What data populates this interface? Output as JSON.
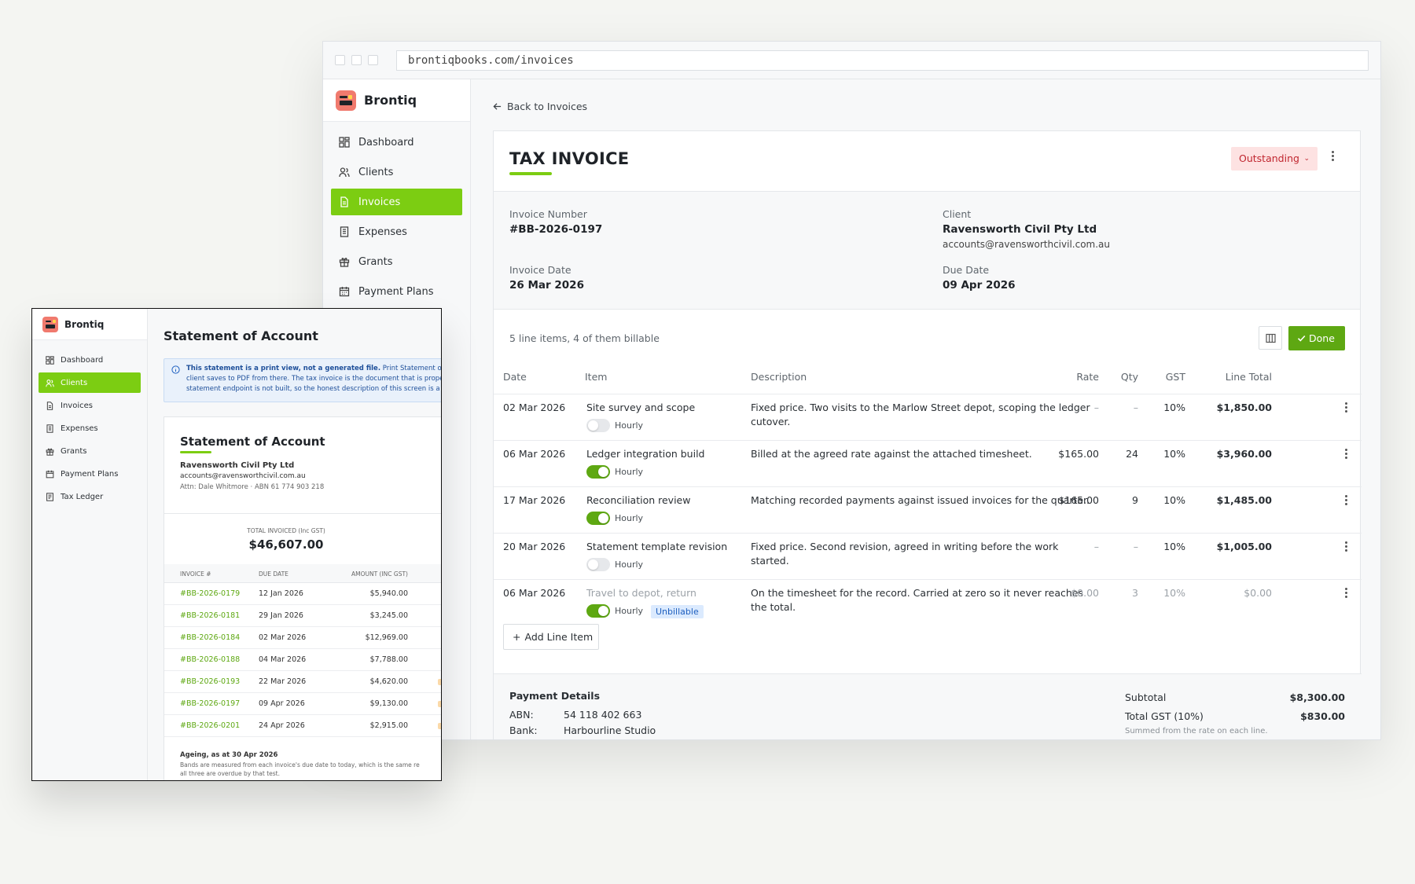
{
  "browser": {
    "url": "brontiqbooks.com/invoices"
  },
  "app": {
    "brand": "Brontiq",
    "nav": [
      {
        "label": "Dashboard",
        "icon": "dashboard-icon"
      },
      {
        "label": "Clients",
        "icon": "users-icon"
      },
      {
        "label": "Invoices",
        "icon": "document-icon",
        "active": true
      },
      {
        "label": "Expenses",
        "icon": "receipt-icon"
      },
      {
        "label": "Grants",
        "icon": "gift-icon"
      },
      {
        "label": "Payment Plans",
        "icon": "calendar-icon"
      }
    ]
  },
  "invoice": {
    "back_label": "Back to Invoices",
    "title": "TAX INVOICE",
    "status": "Outstanding",
    "number_label": "Invoice Number",
    "number": "#BB-2026-0197",
    "client_label": "Client",
    "client_name": "Ravensworth Civil Pty Ltd",
    "client_email": "accounts@ravensworthcivil.com.au",
    "date_label": "Invoice Date",
    "date": "26 Mar 2026",
    "due_label": "Due Date",
    "due": "09 Apr 2026",
    "line_summary": "5 line items, 4 of them billable",
    "done_label": "Done",
    "columns": [
      "Date",
      "Item",
      "Description",
      "Rate",
      "Qty",
      "GST",
      "Line Total"
    ],
    "line_items": [
      {
        "date": "02 Mar 2026",
        "item": "Site survey and scope",
        "desc1": "Fixed price. Two visits to the Marlow Street depot, scoping the ledger",
        "desc2": "cutover.",
        "rate": "–",
        "qty": "–",
        "gst": "10%",
        "total": "$1,850.00",
        "hourly_label": "Hourly",
        "hourly": false
      },
      {
        "date": "06 Mar 2026",
        "item": "Ledger integration build",
        "desc1": "Billed at the agreed rate against the attached timesheet.",
        "desc2": "",
        "rate": "$165.00",
        "qty": "24",
        "gst": "10%",
        "total": "$3,960.00",
        "hourly_label": "Hourly",
        "hourly": true
      },
      {
        "date": "17 Mar 2026",
        "item": "Reconciliation review",
        "desc1": "Matching recorded payments against issued invoices for the quarter.",
        "desc2": "",
        "rate": "$165.00",
        "qty": "9",
        "gst": "10%",
        "total": "$1,485.00",
        "hourly_label": "Hourly",
        "hourly": true
      },
      {
        "date": "20 Mar 2026",
        "item": "Statement template revision",
        "desc1": "Fixed price. Second revision, agreed in writing before the work",
        "desc2": "started.",
        "rate": "–",
        "qty": "–",
        "gst": "10%",
        "total": "$1,005.00",
        "hourly_label": "Hourly",
        "hourly": false
      },
      {
        "date": "06 Mar 2026",
        "item": "Travel to depot, return",
        "desc1": "On the timesheet for the record. Carried at zero so it never reaches",
        "desc2": "the total.",
        "rate": "$0.00",
        "qty": "3",
        "gst": "10%",
        "total": "$0.00",
        "hourly_label": "Hourly",
        "hourly": true,
        "badge": "Unbillable"
      }
    ],
    "add_line_label": "Add Line Item",
    "payment_title": "Payment Details",
    "abn_label": "ABN:",
    "abn": "54 118 402 663",
    "bank_label": "Bank:",
    "bank": "Harbourline Studio",
    "subtotal_label": "Subtotal",
    "subtotal": "$8,300.00",
    "gst_label": "Total GST (10%)",
    "gst_total": "$830.00",
    "gst_note": "Summed from the rate on each line."
  },
  "statement_window": {
    "brand": "Brontiq",
    "nav": [
      {
        "label": "Dashboard",
        "icon": "dashboard-icon"
      },
      {
        "label": "Clients",
        "icon": "users-icon",
        "active": true
      },
      {
        "label": "Invoices",
        "icon": "document-icon"
      },
      {
        "label": "Expenses",
        "icon": "receipt-icon"
      },
      {
        "label": "Grants",
        "icon": "gift-icon"
      },
      {
        "label": "Payment Plans",
        "icon": "calendar-icon"
      },
      {
        "label": "Tax Ledger",
        "icon": "ledger-icon"
      }
    ],
    "page_title": "Statement of Account",
    "info_bold": "This statement is a print view, not a generated file.",
    "info_rest": "Print Statement of",
    "info_line2": "client saves to PDF from there. The tax invoice is the document that is prope",
    "info_line3": "statement endpoint is not built, so the honest description of this screen is a",
    "card_title": "Statement of Account",
    "client_name": "Ravensworth Civil Pty Ltd",
    "client_email": "accounts@ravensworthcivil.com.au",
    "attn": "Attn: Dale Whitmore · ABN 61 774 903 218",
    "total_label": "TOTAL INVOICED (Inc GST)",
    "total_value": "$46,607.00",
    "columns": [
      "INVOICE #",
      "DUE DATE",
      "AMOUNT (INC GST)"
    ],
    "rows": [
      {
        "invoice": "#BB-2026-0179",
        "due": "12 Jan 2026",
        "amount": "$5,940.00",
        "flag": false
      },
      {
        "invoice": "#BB-2026-0181",
        "due": "29 Jan 2026",
        "amount": "$3,245.00",
        "flag": false
      },
      {
        "invoice": "#BB-2026-0184",
        "due": "02 Mar 2026",
        "amount": "$12,969.00",
        "flag": false
      },
      {
        "invoice": "#BB-2026-0188",
        "due": "04 Mar 2026",
        "amount": "$7,788.00",
        "flag": false
      },
      {
        "invoice": "#BB-2026-0193",
        "due": "22 Mar 2026",
        "amount": "$4,620.00",
        "flag": true
      },
      {
        "invoice": "#BB-2026-0197",
        "due": "09 Apr 2026",
        "amount": "$9,130.00",
        "flag": true
      },
      {
        "invoice": "#BB-2026-0201",
        "due": "24 Apr 2026",
        "amount": "$2,915.00",
        "flag": true
      }
    ],
    "ageing_title": "Ageing, as at 30 Apr 2026",
    "ageing_line1": "Bands are measured from each invoice's due date to today, which is the same re",
    "ageing_line2": "all three are overdue by that test."
  }
}
